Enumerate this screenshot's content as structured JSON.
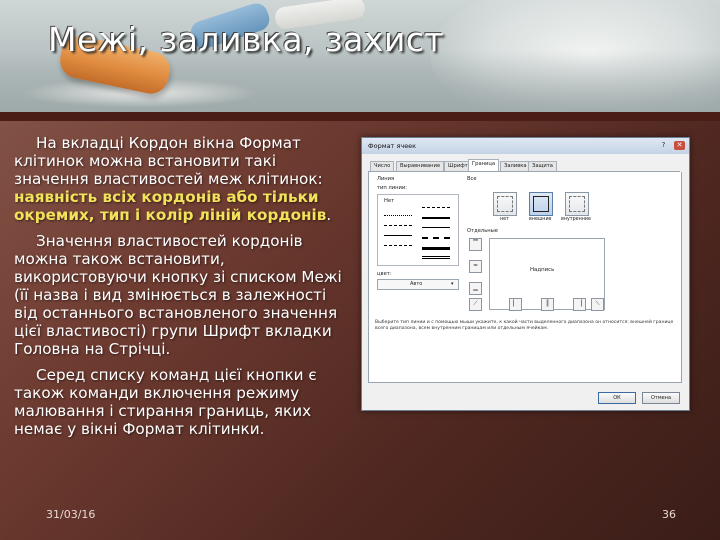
{
  "slide": {
    "title": "Межі, заливка, захист",
    "paragraphs": [
      {
        "before": "На вкладці Кордон вікна Формат клітинок  можна встановити такі значення властивостей меж клітинок: ",
        "highlight": "наявність всіх кордонів або тільки окремих, тип і колір ліній кордонів",
        "after": "."
      },
      {
        "before": "Значення властивостей кордонів можна також встановити, використовуючи кнопку зі списком Межі (її назва і вид змінюється в залежності від останнього встановленого значення цієї властивості) групи Шрифт вкладки Головна на Стрічці.",
        "highlight": "",
        "after": ""
      },
      {
        "before": "Серед списку команд цієї кнопки є також команди включення режиму малювання і стирання границь, яких немає у вікні Формат клітинки.",
        "highlight": "",
        "after": ""
      }
    ],
    "date": "31/03/16",
    "page_number": "36",
    "accent_color": "#f2e15a"
  },
  "dialog": {
    "title": "Формат ячеек",
    "help_label": "?",
    "close_label": "✕",
    "tabs": [
      "Число",
      "Выравнивание",
      "Шрифт",
      "Граница",
      "Заливка",
      "Защита"
    ],
    "active_tab": 3,
    "line_label": "Линия",
    "type_label": "тип линии:",
    "none_label": "Нет",
    "color_label": "цвет:",
    "color_value": "Авто",
    "all_label": "Все",
    "presets": [
      "нет",
      "внешние",
      "внутренние"
    ],
    "border_label": "Отдельные",
    "preview_text": "Надпись",
    "description": "Выберите тип линии и с помощью мыши укажите, к какой части выделенного диапазона он относится: внешней границе всего диапазона, всем внутренним границам или отдельным ячейкам.",
    "ok_label": "ОК",
    "cancel_label": "Отмена"
  }
}
